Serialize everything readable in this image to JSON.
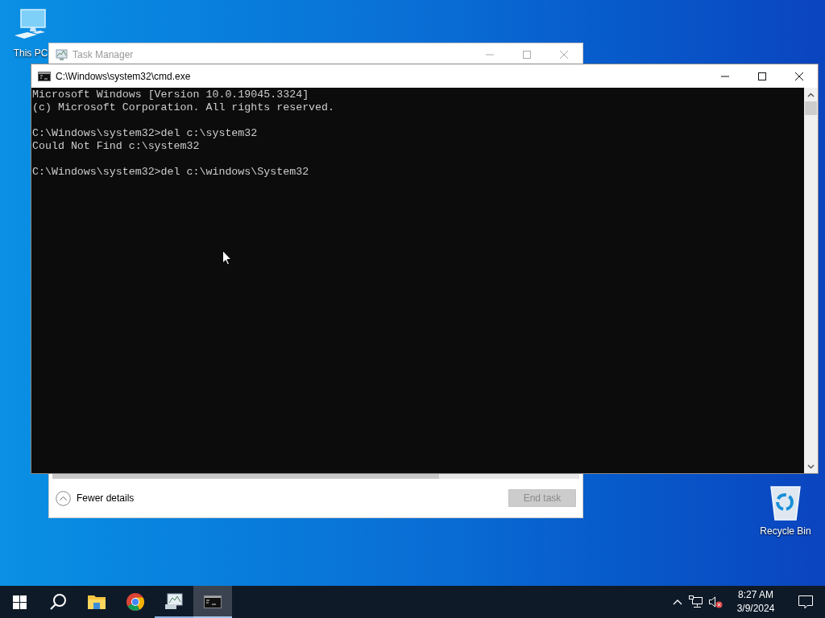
{
  "desktop_icons": [
    {
      "kind": "computer",
      "label": "This PC"
    },
    {
      "kind": "recycle-bin",
      "label": "Recycle Bin"
    }
  ],
  "task_manager": {
    "title": "Task Manager",
    "details_toggle": "Fewer details",
    "end_task": {
      "label": "End task",
      "disabled": true
    }
  },
  "console": {
    "title": "C:\\Windows\\system32\\cmd.exe",
    "blocks": [
      [
        "Microsoft Windows [Version 10.0.19045.3324]",
        "(c) Microsoft Corporation. All rights reserved."
      ],
      [
        "C:\\Windows\\system32>del c:\\system32",
        "Could Not Find c:\\system32"
      ],
      [
        "C:\\Windows\\system32>del c:\\windows\\System32"
      ]
    ]
  },
  "taskbar": {
    "items": [
      {
        "kind": "start",
        "running": false,
        "selected": false
      },
      {
        "kind": "search",
        "running": false,
        "selected": false
      },
      {
        "kind": "explorer",
        "running": false,
        "selected": false
      },
      {
        "kind": "chrome",
        "running": false,
        "selected": false
      },
      {
        "kind": "taskmgr",
        "running": true,
        "selected": false
      },
      {
        "kind": "cmd",
        "running": true,
        "selected": true
      }
    ],
    "tray": {
      "volume_muted": true,
      "time": "8:27 AM",
      "date": "3/9/2024"
    }
  }
}
